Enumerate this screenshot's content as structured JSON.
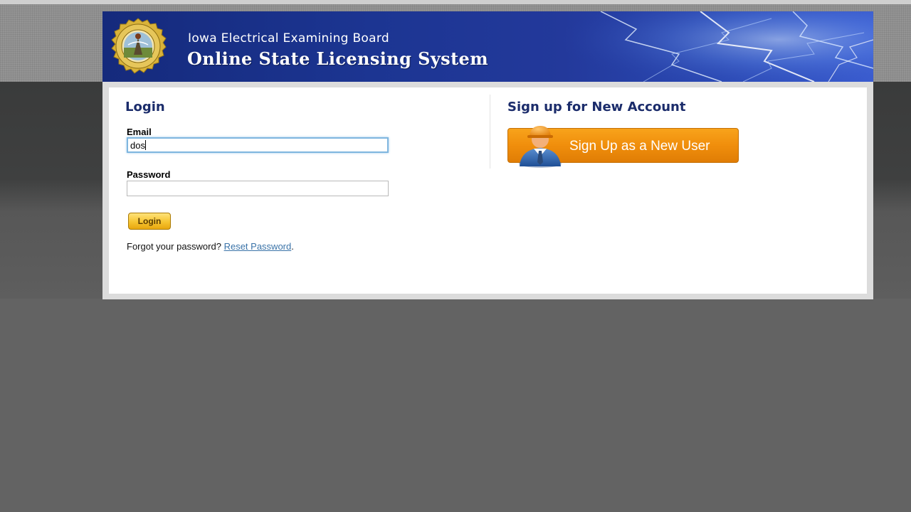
{
  "header": {
    "org_name": "Iowa Electrical Examining Board",
    "system_name": "Online State Licensing System"
  },
  "login": {
    "heading": "Login",
    "email_label": "Email",
    "email_value": "dos",
    "password_label": "Password",
    "password_value": "",
    "button_label": "Login",
    "forgot_text": "Forgot your password?",
    "reset_link": "Reset Password",
    "trailing": "."
  },
  "signup": {
    "heading": "Sign up for New Account",
    "button_label": "Sign Up as a New User"
  },
  "colors": {
    "accent_orange": "#f08e0c",
    "heading_navy": "#1b2c6b",
    "link_blue": "#3a73a8",
    "header_blue": "#1c3592"
  },
  "icons": [
    "state-seal-icon",
    "new-user-icon",
    "lightning-banner-graphic"
  ]
}
